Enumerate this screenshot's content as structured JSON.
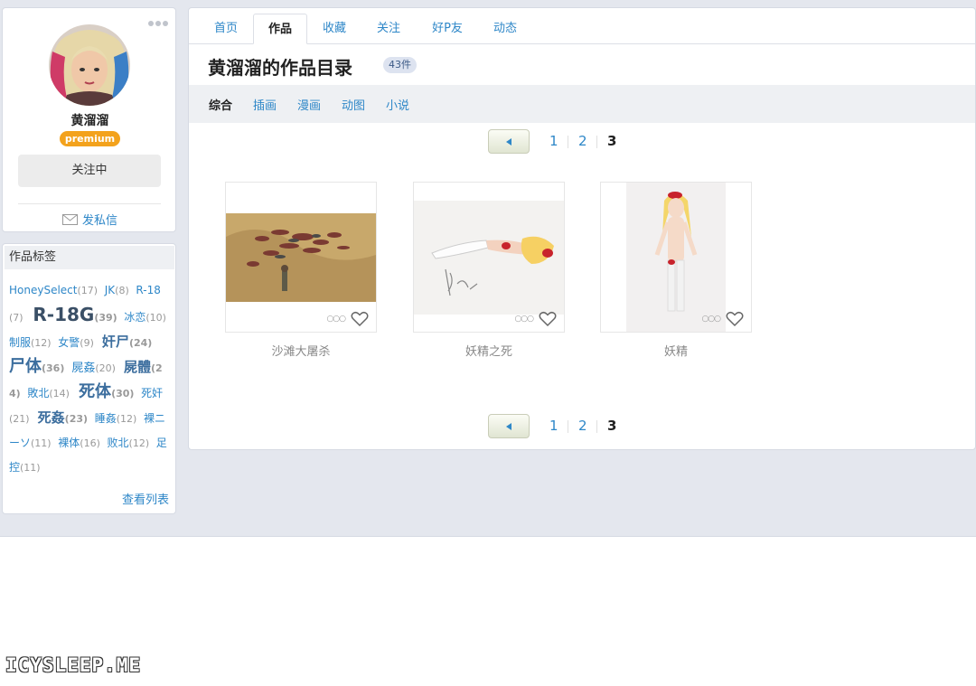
{
  "profile": {
    "username": "黄溜溜",
    "premium_label": "premium",
    "follow_button": "关注中",
    "message_link": "发私信"
  },
  "tags": {
    "header": "作品标签",
    "view_list": "查看列表",
    "items": [
      {
        "name": "HoneySelect",
        "count": "(17)"
      },
      {
        "name": "JK",
        "count": "(8)"
      },
      {
        "name": "R-18",
        "count": "(7)"
      },
      {
        "name": "R-18G",
        "count": "(39)"
      },
      {
        "name": "冰恋",
        "count": "(10)"
      },
      {
        "name": "制服",
        "count": "(12)"
      },
      {
        "name": "女警",
        "count": "(9)"
      },
      {
        "name": "奸尸",
        "count": "(24)"
      },
      {
        "name": "尸体",
        "count": "(36)"
      },
      {
        "name": "屍姦",
        "count": "(20)"
      },
      {
        "name": "屍體",
        "count": "(24)"
      },
      {
        "name": "敗北",
        "count": "(14)"
      },
      {
        "name": "死体",
        "count": "(30)"
      },
      {
        "name": "死奸",
        "count": "(21)"
      },
      {
        "name": "死姦",
        "count": "(23)"
      },
      {
        "name": "睡姦",
        "count": "(12)"
      },
      {
        "name": "裸ニーソ",
        "count": "(11)"
      },
      {
        "name": "裸体",
        "count": "(16)"
      },
      {
        "name": "败北",
        "count": "(12)"
      },
      {
        "name": "足控",
        "count": "(11)"
      }
    ]
  },
  "tabs": [
    "首页",
    "作品",
    "收藏",
    "关注",
    "好P友",
    "动态"
  ],
  "page_title": "黄溜溜的作品目录",
  "count_badge": "43件",
  "filters": [
    "综合",
    "插画",
    "漫画",
    "动图",
    "小说"
  ],
  "pagination": {
    "pages": [
      "1",
      "2",
      "3"
    ],
    "current": "3"
  },
  "works": [
    {
      "title": "沙滩大屠杀"
    },
    {
      "title": "妖精之死"
    },
    {
      "title": "妖精"
    }
  ],
  "watermark": "ICYSLEEP.ME",
  "colors": {
    "link": "#2e87c8",
    "premium": "#f3a21c",
    "background": "#e4e7ee"
  }
}
